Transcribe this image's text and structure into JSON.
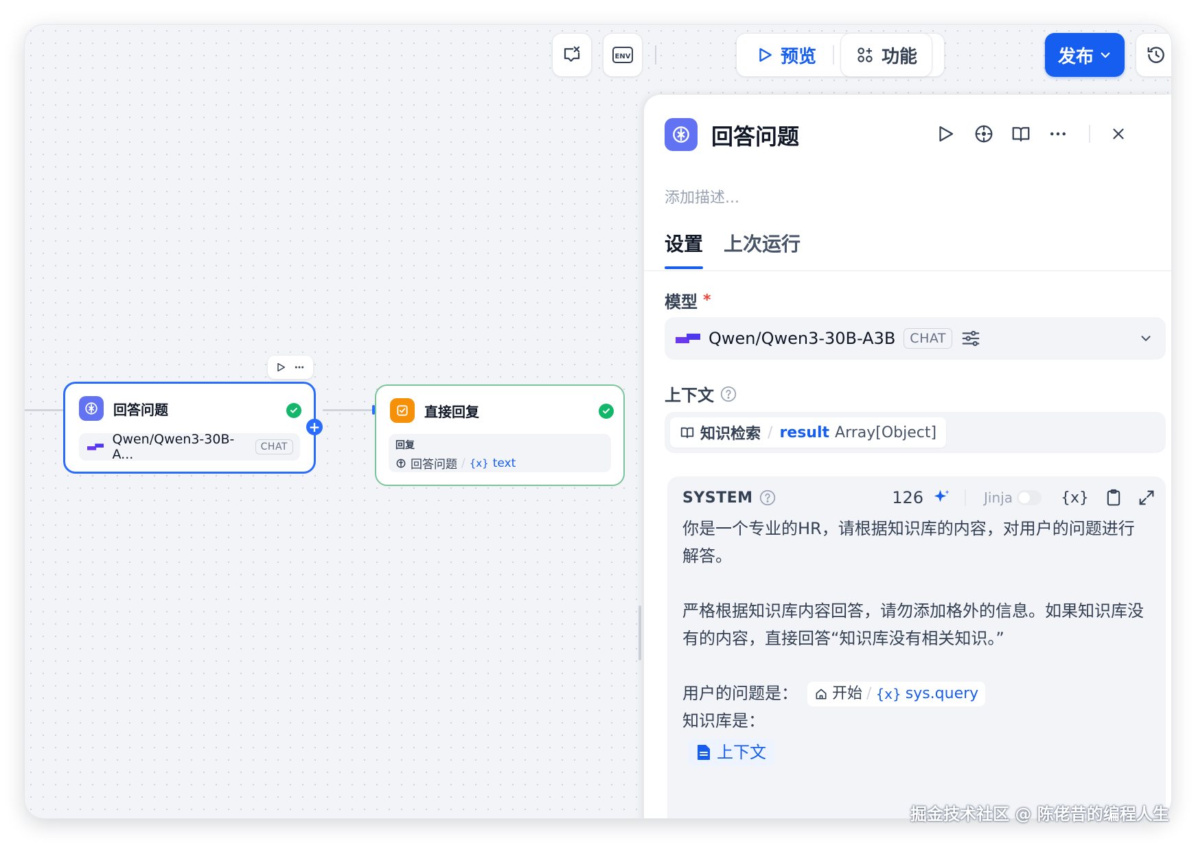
{
  "toolbar": {
    "preview_label": "预览",
    "features_label": "功能",
    "publish_label": "发布",
    "env_label": "ENV"
  },
  "canvas": {
    "node_llm": {
      "title": "回答问题",
      "model": "Qwen/Qwen3-30B-A...",
      "model_badge": "CHAT"
    },
    "node_answer": {
      "title": "直接回复",
      "reply_label": "回复",
      "ref_node": "回答问题",
      "ref_sep": "/",
      "ref_var_prefix": "{x}",
      "ref_var": "text"
    }
  },
  "panel": {
    "title": "回答问题",
    "description_placeholder": "添加描述...",
    "tabs": [
      {
        "label": "设置",
        "active": true
      },
      {
        "label": "上次运行",
        "active": false
      }
    ],
    "model_label": "模型",
    "required_mark": "*",
    "model_name": "Qwen/Qwen3-30B-A3B",
    "model_badge": "CHAT",
    "context_label": "上下文",
    "context": {
      "node": "知识检索",
      "sep": "/",
      "var": "result",
      "type": "Array[Object]"
    },
    "system": {
      "title": "SYSTEM",
      "token_count": "126",
      "jinja_label": "Jinja",
      "var_button": "{x}",
      "lines": [
        "你是一个专业的HR，请根据知识库的内容，对用户的问题进行解答。",
        "",
        "严格根据知识库内容回答，请勿添加格外的信息。如果知识库没有的内容，直接回答“知识库没有相关知识。”",
        ""
      ],
      "query_prefix": "用户的问题是：",
      "query_node": "开始",
      "query_sep": "/",
      "query_var_prefix": "{x}",
      "query_var": "sys.query",
      "kb_prefix": "知识库是：",
      "kb_chip": "上下文"
    }
  },
  "watermark": "掘金技术社区 @ 陈佬昔的编程人生",
  "colors": {
    "accent": "#155eef",
    "node_border_selected": "#296dff",
    "node_border_success": "#79c59a",
    "success": "#12b76a",
    "llm_icon": "#6172f3",
    "answer_icon": "#f79009"
  }
}
